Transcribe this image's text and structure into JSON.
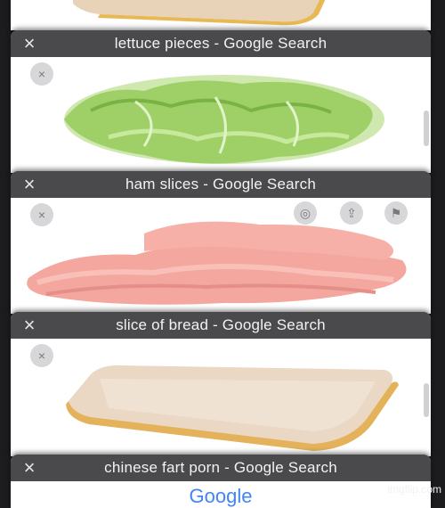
{
  "cards": [
    {
      "title": "lettuce pieces - Google Search"
    },
    {
      "title": "ham slices - Google Search"
    },
    {
      "title": "slice of bread - Google Search"
    },
    {
      "title": "chinese fart porn - Google Search",
      "preview_text": "Google"
    }
  ],
  "icons": {
    "close": "×",
    "image_close": "×"
  },
  "colors": {
    "tab_bar": "#4a4a4c",
    "background": "#1c1c1e"
  },
  "watermark": "imgflip.com"
}
